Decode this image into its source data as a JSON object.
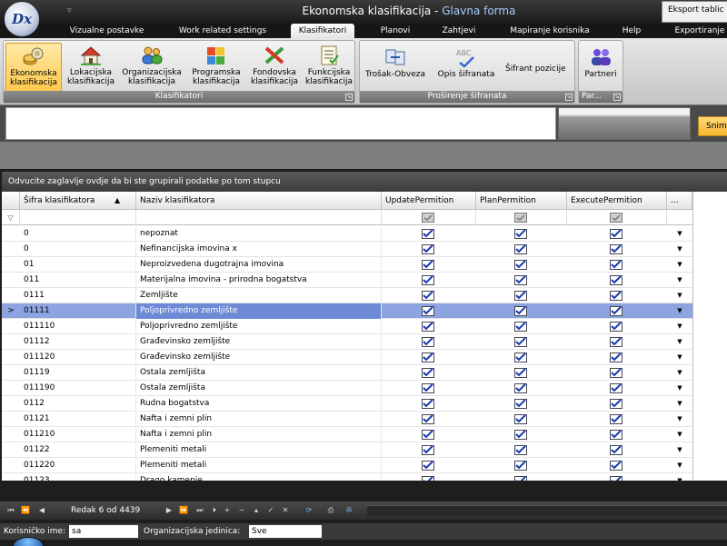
{
  "window": {
    "title": "Ekonomska klasifikacija",
    "title_separator": " - ",
    "subtitle": "Glavna forma",
    "logo_text": "Dx",
    "export_button": "Eksport tablic"
  },
  "tabs": [
    {
      "label": "Vizualne postavke"
    },
    {
      "label": "Work related settings"
    },
    {
      "label": "Klasifikatori"
    },
    {
      "label": "Planovi"
    },
    {
      "label": "Zahtjevi"
    },
    {
      "label": "Mapiranje korisnika"
    },
    {
      "label": "Help"
    },
    {
      "label": "Exportiranje"
    }
  ],
  "ribbon": {
    "klasifikatori_group": {
      "label": "Klasifikatori",
      "buttons": [
        {
          "line1": "Ekonomska",
          "line2": "klasifikacija",
          "icon": "coins-icon"
        },
        {
          "line1": "Lokacijska",
          "line2": "klasifikacija",
          "icon": "house-icon"
        },
        {
          "line1": "Organizacijska",
          "line2": "klasifikacija",
          "icon": "people-icon"
        },
        {
          "line1": "Programska",
          "line2": "klasifikacija",
          "icon": "puzzle-icon"
        },
        {
          "line1": "Fondovska",
          "line2": "klasifikacija",
          "icon": "fund-icon"
        },
        {
          "line1": "Funkcijska",
          "line2": "klasifikacija",
          "icon": "checklist-icon"
        }
      ]
    },
    "prosirenje_group": {
      "label": "Proširenje šifranata",
      "buttons": [
        {
          "label": "Trošak-Obveza",
          "icon": "transfer-icon"
        },
        {
          "label": "Opis šifranata",
          "icon": "abc-icon"
        },
        {
          "label": "Šifrant pozicije"
        }
      ]
    },
    "partneri_group": {
      "label": "Par...",
      "buttons": [
        {
          "label": "Partneri",
          "icon": "partners-icon"
        }
      ]
    }
  },
  "filter_panel": {
    "snimi_button": "Snim"
  },
  "grid": {
    "group_panel_text": "Odvucite zaglavlje ovdje da bi ste grupirali podatke po tom stupcu",
    "columns": {
      "sifra": "Šifra klasifikatora",
      "naziv": "Naziv klasifikatora",
      "update": "UpdatePermition",
      "plan": "PlanPermition",
      "execute": "ExecutePermition",
      "more": "..."
    },
    "sort_arrow": "▲",
    "filter_icon": "▽",
    "row_indicator": ">",
    "dropdown_glyph": "▼",
    "rows": [
      {
        "sifra": "0",
        "naziv": "nepoznat"
      },
      {
        "sifra": "0",
        "naziv": "Nefinancijska imovina x"
      },
      {
        "sifra": "01",
        "naziv": "Neproizvedena dugotrajna imovina"
      },
      {
        "sifra": "011",
        "naziv": "Materijalna imovina - prirodna bogatstva"
      },
      {
        "sifra": "0111",
        "naziv": "Zemljište"
      },
      {
        "sifra": "01111",
        "naziv": "Poljoprivredno zemljište"
      },
      {
        "sifra": "011110",
        "naziv": "Poljoprivredno zemljište"
      },
      {
        "sifra": "01112",
        "naziv": "Građevinsko zemljište"
      },
      {
        "sifra": "011120",
        "naziv": "Građevinsko zemljište"
      },
      {
        "sifra": "01119",
        "naziv": "Ostala zemljišta"
      },
      {
        "sifra": "011190",
        "naziv": "Ostala zemljišta"
      },
      {
        "sifra": "0112",
        "naziv": "Rudna bogatstva"
      },
      {
        "sifra": "01121",
        "naziv": "Nafta i zemni plin"
      },
      {
        "sifra": "011210",
        "naziv": "Nafta i zemni plin"
      },
      {
        "sifra": "01122",
        "naziv": "Plemeniti metali"
      },
      {
        "sifra": "011220",
        "naziv": "Plemeniti metali"
      },
      {
        "sifra": "01123",
        "naziv": "Drago kamenje"
      }
    ],
    "selected_row": 5
  },
  "navigator": {
    "record_text": "Redak 6 od 4439"
  },
  "status": {
    "user_label": "Korisničko ime:",
    "user_value": "sa",
    "org_label": "Organizacijska jedinica:",
    "org_value": "Sve"
  }
}
